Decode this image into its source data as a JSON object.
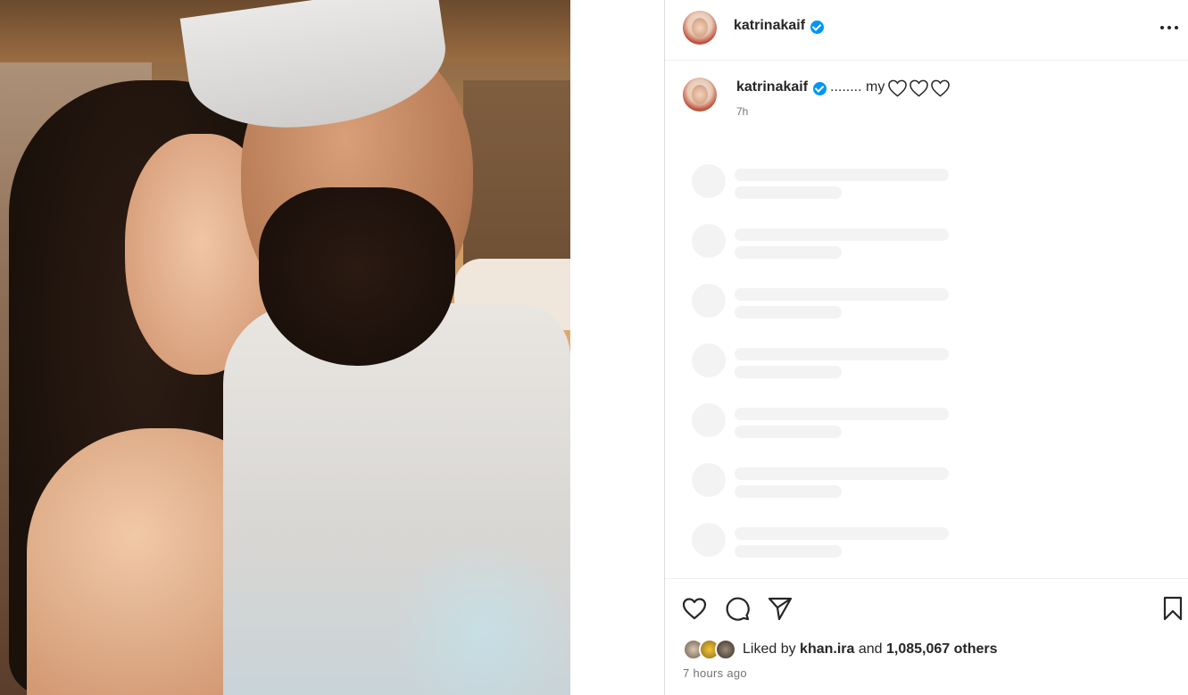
{
  "post": {
    "author": "katrinakaif",
    "caption_text": "........ my",
    "caption_emoji": [
      "white-heart",
      "white-heart",
      "white-heart"
    ],
    "caption_time": "7h",
    "likes_prefix": "Liked by",
    "liked_by": "khan.ira",
    "likes_and": "and",
    "likes_count": "1,085,067 others",
    "timestamp": "7 hours ago"
  },
  "icons": {
    "more": "more-options-icon",
    "like": "heart-icon",
    "comment": "comment-icon",
    "share": "share-icon",
    "save": "bookmark-icon",
    "verified": "verified-badge-icon"
  },
  "colors": {
    "verified": "#0095f6",
    "text": "#262626",
    "secondary": "#737373",
    "skeleton": "#f3f3f3",
    "divider": "#efefef"
  },
  "comments": {
    "loading_placeholders": 7
  }
}
